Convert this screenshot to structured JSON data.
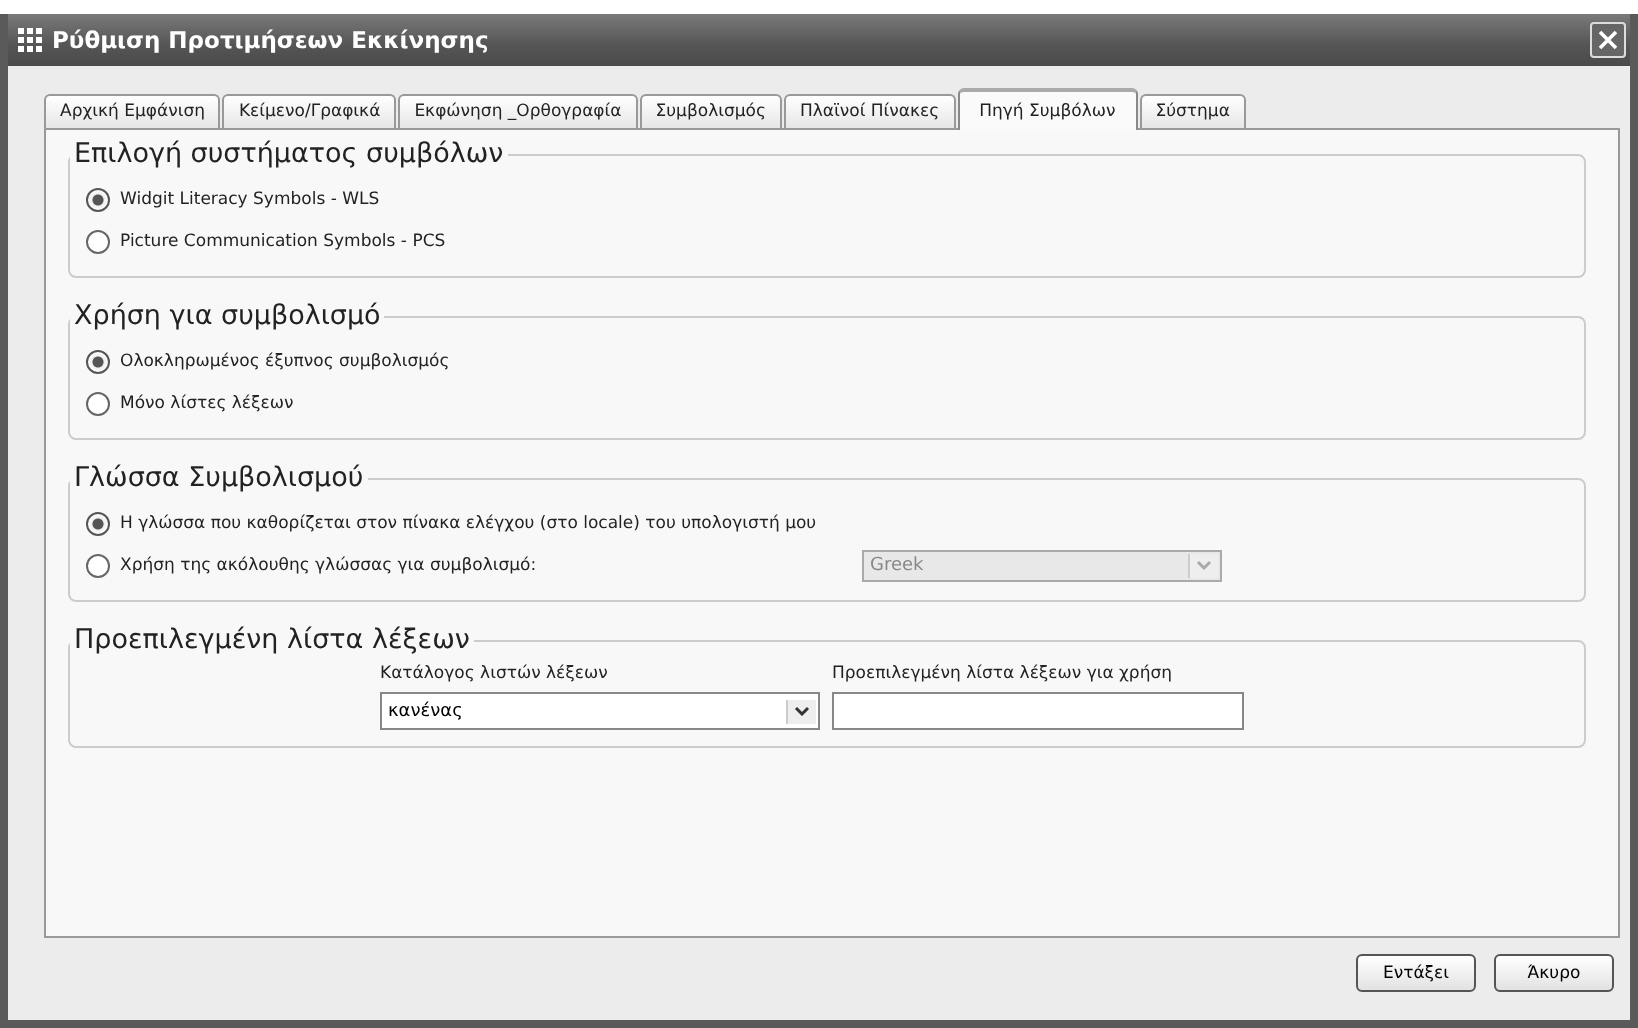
{
  "window": {
    "title": "Ρύθμιση Προτιμήσεων Εκκίνησης"
  },
  "tabs": [
    {
      "label": "Αρχική Εμφάνιση",
      "selected": false
    },
    {
      "label": "Κείμενο/Γραφικά",
      "selected": false
    },
    {
      "label": "Εκφώνηση _Ορθογραφία",
      "selected": false
    },
    {
      "label": "Συμβολισμός",
      "selected": false
    },
    {
      "label": "Πλαϊνοί Πίνακες",
      "selected": false
    },
    {
      "label": "Πηγή Συμβόλων",
      "selected": true
    },
    {
      "label": "Σύστημα",
      "selected": false
    }
  ],
  "groups": [
    {
      "kind": "radios",
      "title": "Επιλογή συστήματος συμβόλων",
      "options": [
        {
          "label": "Widgit Literacy Symbols - WLS",
          "selected": true
        },
        {
          "label": "Picture Communication Symbols - PCS",
          "selected": false
        }
      ]
    },
    {
      "kind": "radios",
      "title": "Χρήση για συμβολισμό",
      "options": [
        {
          "label": "Ολοκληρωμένος έξυπνος συμβολισμός",
          "selected": true
        },
        {
          "label": "Μόνο λίστες λέξεων",
          "selected": false
        }
      ]
    },
    {
      "kind": "radios",
      "title": "Γλώσσα Συμβολισμού",
      "options": [
        {
          "label": "Η γλώσσα που καθορίζεται στον πίνακα ελέγχου (στο locale) του υπολογιστή μου",
          "selected": true
        },
        {
          "label": "Χρήση της ακόλουθης γλώσσας για συμβολισμό:",
          "selected": false,
          "dropdown": {
            "value": "Greek",
            "disabled": true
          }
        }
      ]
    },
    {
      "kind": "lists",
      "title": "Προεπιλεγμένη λίστα λέξεων",
      "catalog": {
        "label": "Κατάλογος λιστών λέξεων",
        "value": "κανένας"
      },
      "default_list": {
        "label": "Προεπιλεγμένη λίστα λέξεων για χρήση"
      }
    }
  ],
  "buttons": [
    {
      "label": "Εντάξει"
    },
    {
      "label": "Άκυρο"
    }
  ]
}
